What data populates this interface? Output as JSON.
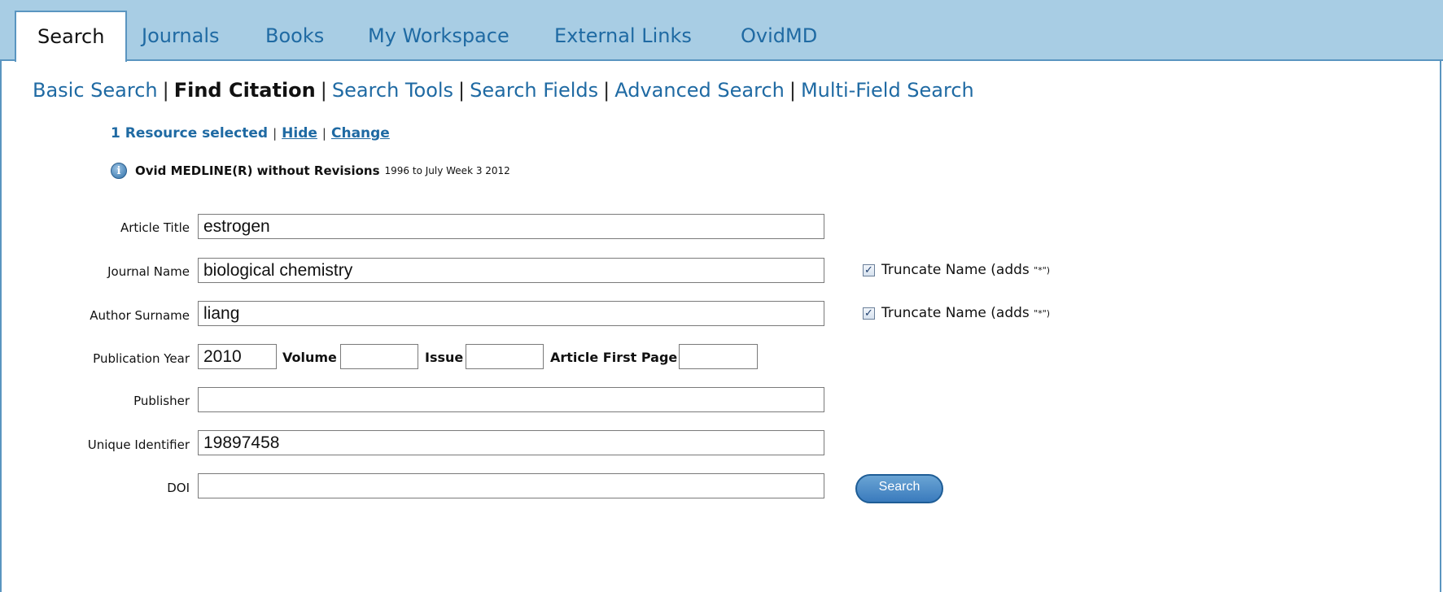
{
  "tabs": [
    {
      "label": "Search",
      "active": true
    },
    {
      "label": "Journals"
    },
    {
      "label": "Books"
    },
    {
      "label": "My Workspace"
    },
    {
      "label": "External Links"
    },
    {
      "label": "OvidMD"
    }
  ],
  "subnav": {
    "items": [
      "Basic Search",
      "Find Citation",
      "Search Tools",
      "Search Fields",
      "Advanced Search",
      "Multi-Field Search"
    ],
    "separator": "|",
    "current": "Find Citation"
  },
  "resources": {
    "selected_text": "1 Resource selected",
    "separator": "|",
    "hide_label": "Hide",
    "change_label": "Change",
    "info_icon": "info-icon",
    "info_glyph": "i",
    "database_name": "Ovid MEDLINE(R) without Revisions",
    "database_range": "1996 to July Week 3 2012"
  },
  "form": {
    "article_title": {
      "label": "Article Title",
      "value": "estrogen"
    },
    "journal_name": {
      "label": "Journal Name",
      "value": "biological chemistry"
    },
    "author_surname": {
      "label": "Author Surname",
      "value": "liang"
    },
    "publication_year": {
      "label": "Publication Year",
      "value": "2010"
    },
    "volume": {
      "label": "Volume",
      "value": ""
    },
    "issue": {
      "label": "Issue",
      "value": ""
    },
    "article_first_page": {
      "label": "Article First Page",
      "value": ""
    },
    "publisher": {
      "label": "Publisher",
      "value": ""
    },
    "unique_identifier": {
      "label": "Unique Identifier",
      "value": "19897458"
    },
    "doi": {
      "label": "DOI",
      "value": ""
    },
    "truncate_label": "Truncate Name (adds",
    "truncate_suffix": "\"*\")",
    "truncate_journal_checked": true,
    "truncate_author_checked": true,
    "search_button": "Search"
  },
  "colors": {
    "tab_bar": "#a8cde4",
    "link_blue": "#1f6aa3",
    "button_blue": "#3a7bbd"
  }
}
